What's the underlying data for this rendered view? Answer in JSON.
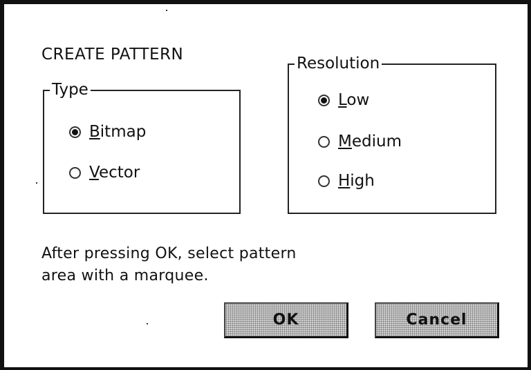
{
  "dialog": {
    "title": "CREATE PATTERN",
    "instructions_line1": "After pressing OK, select pattern",
    "instructions_line2": "area with a marquee."
  },
  "type_group": {
    "legend": "Type",
    "options": [
      {
        "mnemonic": "B",
        "rest": "itmap",
        "selected": true
      },
      {
        "mnemonic": "V",
        "rest": "ector",
        "selected": false
      }
    ]
  },
  "resolution_group": {
    "legend": "Resolution",
    "options": [
      {
        "mnemonic": "L",
        "rest": "ow",
        "selected": true
      },
      {
        "mnemonic": "M",
        "rest": "edium",
        "selected": false
      },
      {
        "mnemonic": "H",
        "rest": "igh",
        "selected": false
      }
    ]
  },
  "buttons": {
    "ok": "OK",
    "cancel": "Cancel"
  }
}
